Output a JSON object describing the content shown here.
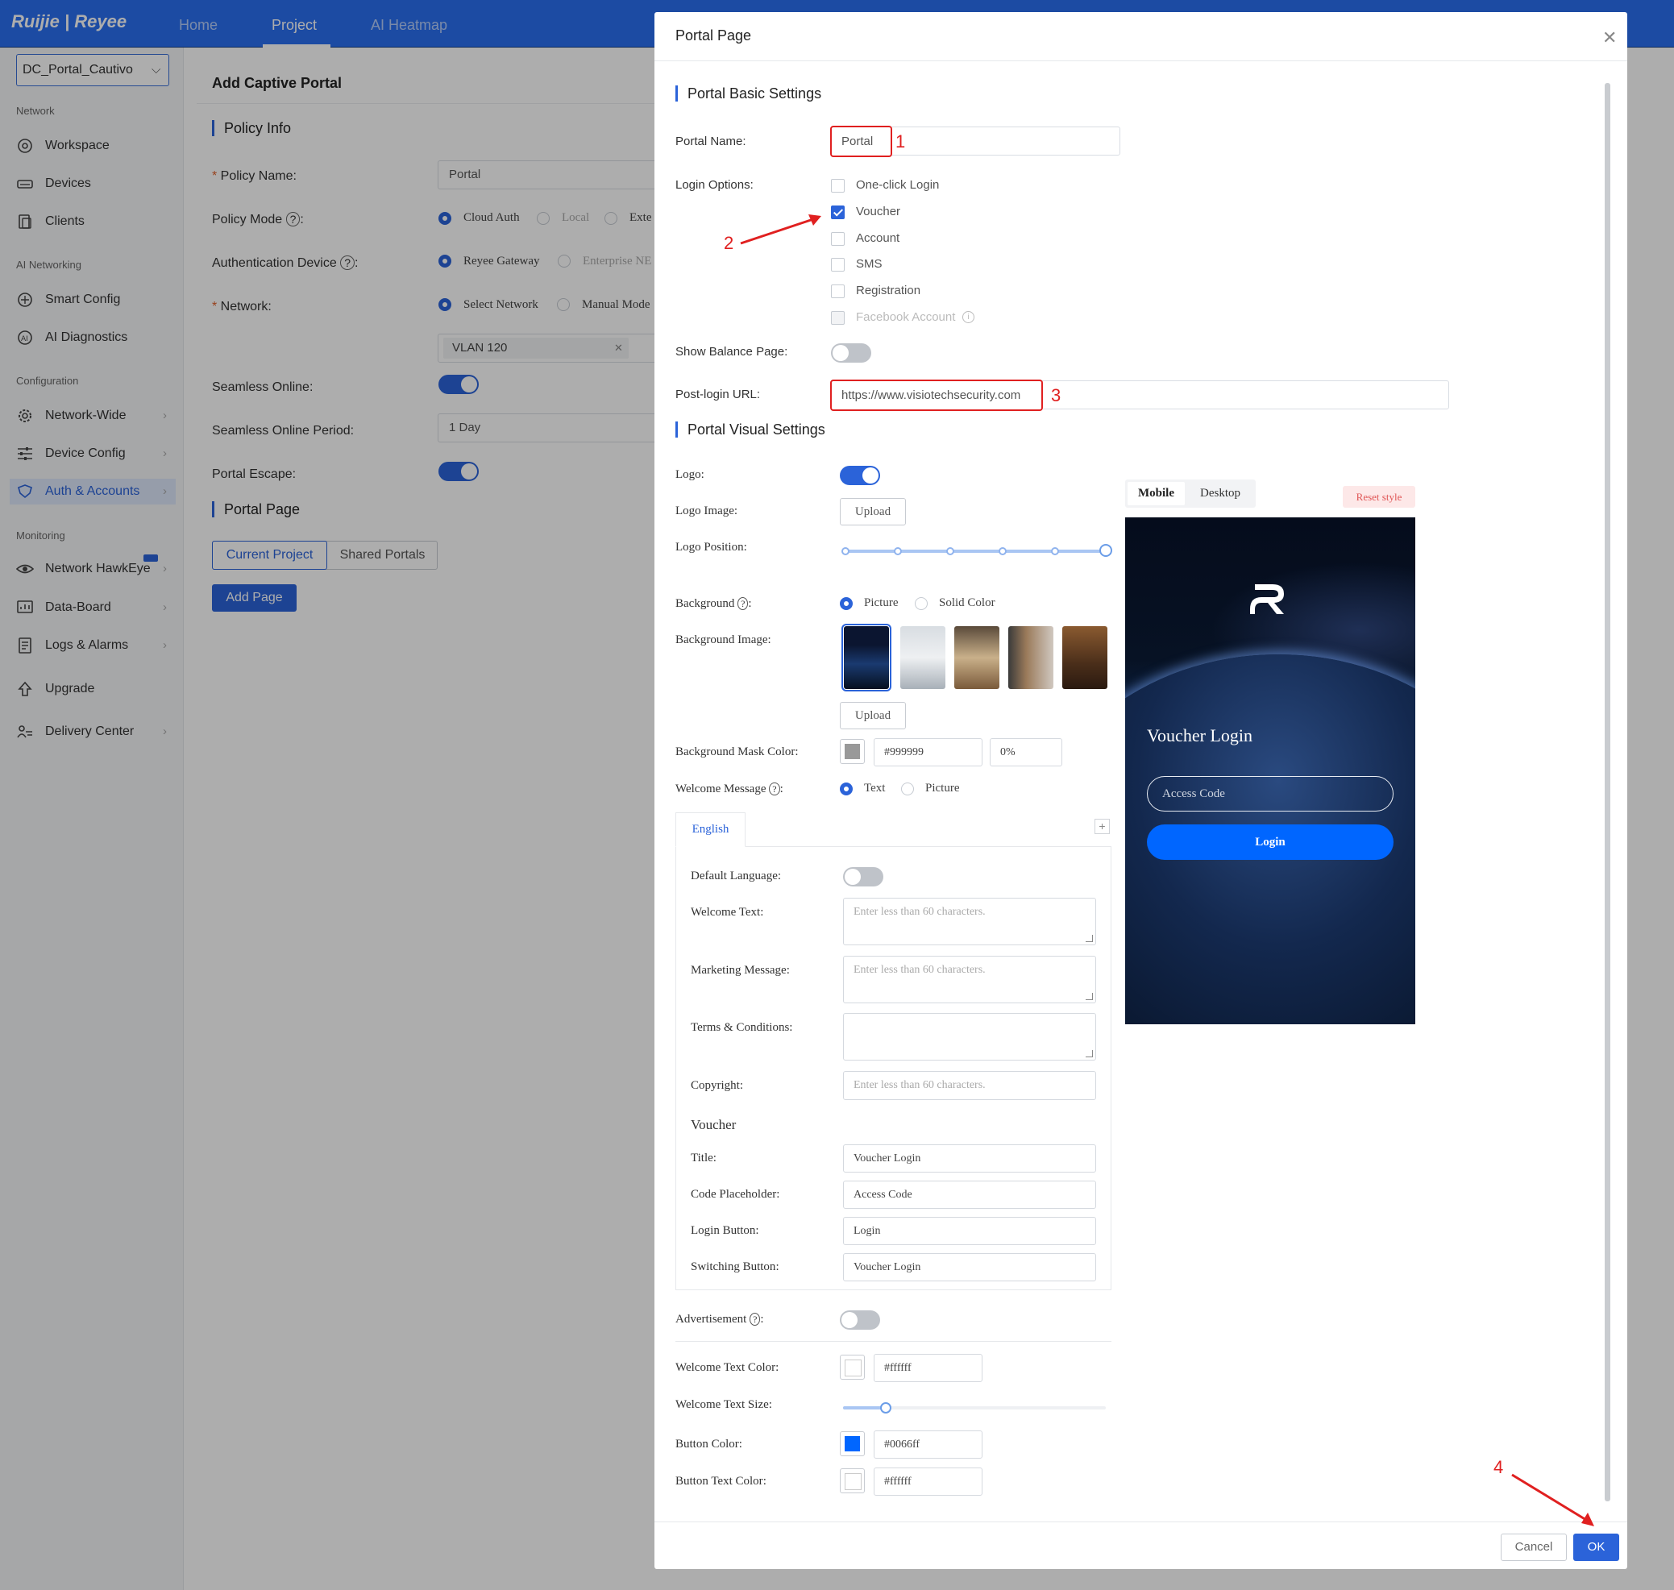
{
  "app": {
    "logo_text": "Ruijie | Reyee",
    "nav": [
      "Home",
      "Project",
      "AI Heatmap"
    ]
  },
  "sidebar": {
    "project_select": "DC_Portal_Cautivo",
    "sections": {
      "network": "Network",
      "ai_networking": "AI Networking",
      "configuration": "Configuration",
      "monitoring": "Monitoring"
    },
    "items": {
      "workspace": "Workspace",
      "devices": "Devices",
      "clients": "Clients",
      "smart_config": "Smart Config",
      "ai_diagnostics": "AI Diagnostics",
      "network_wide": "Network-Wide",
      "device_config": "Device Config",
      "auth_accounts": "Auth & Accounts",
      "network_hawkeye": "Network HawkEye",
      "data_board": "Data-Board",
      "logs_alarms": "Logs & Alarms",
      "upgrade": "Upgrade",
      "delivery_center": "Delivery Center"
    }
  },
  "page": {
    "title": "Add Captive Portal",
    "policy_info": "Policy Info",
    "policy_name_label": "Policy Name",
    "policy_name_value": "Portal",
    "policy_mode_label": "Policy Mode",
    "policy_mode_options": [
      "Cloud Auth",
      "Local",
      "Exte"
    ],
    "auth_device_label": "Authentication Device",
    "auth_device_options": [
      "Reyee Gateway",
      "Enterprise NE"
    ],
    "network_label": "Network",
    "network_options": [
      "Select Network",
      "Manual Mode"
    ],
    "network_tag": "VLAN 120",
    "seamless_online_label": "Seamless Online",
    "seamless_period_label": "Seamless Online Period",
    "seamless_period_value": "1 Day",
    "portal_escape_label": "Portal Escape",
    "portal_page_title": "Portal Page",
    "tabs": [
      "Current Project",
      "Shared Portals"
    ],
    "add_page_button": "Add Page"
  },
  "modal": {
    "title": "Portal Page",
    "basic_settings": "Portal Basic Settings",
    "portal_name_label": "Portal Name",
    "portal_name_value": "Portal",
    "login_options_label": "Login Options",
    "login_options": [
      {
        "label": "One-click Login",
        "checked": false
      },
      {
        "label": "Voucher",
        "checked": true
      },
      {
        "label": "Account",
        "checked": false
      },
      {
        "label": "SMS",
        "checked": false
      },
      {
        "label": "Registration",
        "checked": false
      },
      {
        "label": "Facebook Account",
        "checked": false
      }
    ],
    "show_balance_label": "Show Balance Page",
    "post_login_label": "Post-login URL",
    "post_login_value": "https://www.visiotechsecurity.com",
    "visual_settings": "Portal Visual Settings",
    "logo_label": "Logo",
    "logo_image_label": "Logo Image",
    "upload": "Upload",
    "logo_position_label": "Logo Position",
    "background_label": "Background",
    "background_options": [
      "Picture",
      "Solid Color"
    ],
    "background_image_label": "Background Image",
    "mask_color_label": "Background Mask Color",
    "mask_color_value": "#999999",
    "mask_opacity_value": "0%",
    "welcome_message_label": "Welcome Message",
    "welcome_message_options": [
      "Text",
      "Picture"
    ],
    "lang_tab": "English",
    "lang_add": "+",
    "default_language_label": "Default Language",
    "welcome_text_label": "Welcome Text",
    "welcome_text_placeholder": "Enter less than 60 characters.",
    "marketing_label": "Marketing Message",
    "marketing_placeholder": "Enter less than 60 characters.",
    "terms_label": "Terms & Conditions",
    "copyright_label": "Copyright",
    "copyright_placeholder": "Enter less than 60 characters.",
    "voucher_section": "Voucher",
    "title_label": "Title",
    "title_value": "Voucher Login",
    "code_placeholder_label": "Code Placeholder",
    "code_placeholder_value": "Access Code",
    "login_button_label": "Login Button",
    "login_button_value": "Login",
    "switching_button_label": "Switching Button",
    "switching_button_value": "Voucher Login",
    "advertisement_label": "Advertisement",
    "welcome_text_color_label": "Welcome Text Color",
    "welcome_text_color_value": "#ffffff",
    "welcome_text_size_label": "Welcome Text Size",
    "button_color_label": "Button Color",
    "button_color_value": "#0066ff",
    "button_text_color_label": "Button Text Color",
    "button_text_color_value": "#ffffff",
    "cancel": "Cancel",
    "ok": "OK"
  },
  "preview": {
    "tabs": [
      "Mobile",
      "Desktop"
    ],
    "reset_style": "Reset style",
    "title": "Voucher Login",
    "code_placeholder": "Access Code",
    "login_button": "Login"
  },
  "annotations": [
    "1",
    "2",
    "3",
    "4"
  ],
  "colors": {
    "accent": "#2b63d9",
    "topbar": "#2a6ff0",
    "annotation": "#e02020",
    "preview_button": "#0066ff"
  }
}
